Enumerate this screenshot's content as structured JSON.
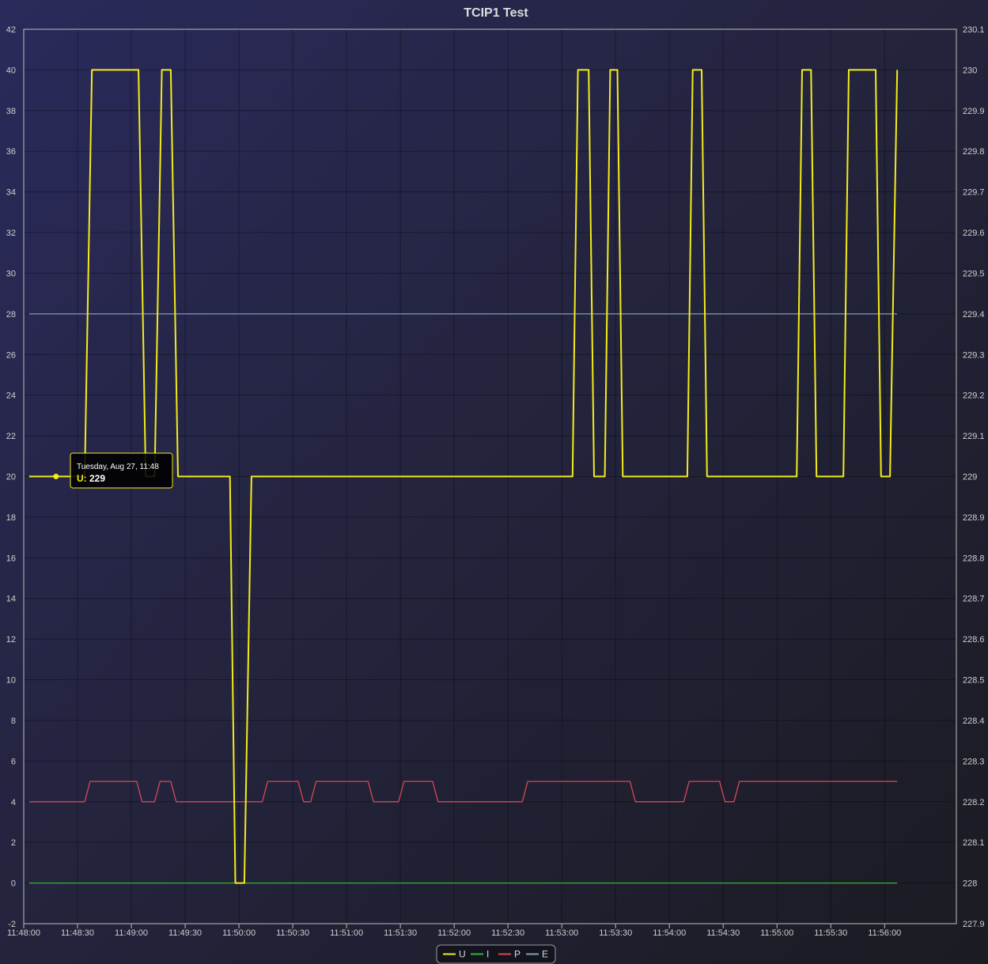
{
  "chart_data": {
    "type": "line",
    "title": "TCIP1 Test",
    "xlabel": "",
    "ylabel": "",
    "x_ticks": [
      "11:48:00",
      "11:48:30",
      "11:49:00",
      "11:49:30",
      "11:50:00",
      "11:50:30",
      "11:51:00",
      "11:51:30",
      "11:52:00",
      "11:52:30",
      "11:53:00",
      "11:53:30",
      "11:54:00",
      "11:54:30",
      "11:55:00",
      "11:55:30",
      "11:56:00"
    ],
    "xlim_seconds": [
      "11:48:00",
      "11:56:40"
    ],
    "ylim_left": [
      -2,
      42
    ],
    "ylim_right": [
      227.9,
      230.1
    ],
    "y_ticks_left": [
      "-2",
      "0",
      "2",
      "4",
      "6",
      "8",
      "10",
      "12",
      "14",
      "16",
      "18",
      "20",
      "22",
      "24",
      "26",
      "28",
      "30",
      "32",
      "34",
      "36",
      "38",
      "40",
      "42"
    ],
    "y_ticks_right": [
      "227.9",
      "228",
      "228.1",
      "228.2",
      "228.3",
      "228.4",
      "228.5",
      "228.6",
      "228.7",
      "228.8",
      "228.9",
      "229",
      "229.1",
      "229.2",
      "229.3",
      "229.4",
      "229.5",
      "229.6",
      "229.7",
      "229.8",
      "229.9",
      "230",
      "230.1"
    ],
    "grid": true,
    "legend_position": "bottom-center",
    "series": [
      {
        "name": "U",
        "axis": "left",
        "color": "#f3ec19",
        "points": [
          [
            "11:48:03",
            20
          ],
          [
            "11:48:34",
            20
          ],
          [
            "11:48:38",
            40
          ],
          [
            "11:49:04",
            40
          ],
          [
            "11:49:08",
            20
          ],
          [
            "11:49:13",
            20
          ],
          [
            "11:49:17",
            40
          ],
          [
            "11:49:22",
            40
          ],
          [
            "11:49:26",
            20
          ],
          [
            "11:49:55",
            20
          ],
          [
            "11:49:58",
            0
          ],
          [
            "11:50:03",
            0
          ],
          [
            "11:50:07",
            20
          ],
          [
            "11:53:06",
            20
          ],
          [
            "11:53:09",
            40
          ],
          [
            "11:53:15",
            40
          ],
          [
            "11:53:18",
            20
          ],
          [
            "11:53:24",
            20
          ],
          [
            "11:53:27",
            40
          ],
          [
            "11:53:31",
            40
          ],
          [
            "11:53:34",
            20
          ],
          [
            "11:54:10",
            20
          ],
          [
            "11:54:13",
            40
          ],
          [
            "11:54:18",
            40
          ],
          [
            "11:54:21",
            20
          ],
          [
            "11:55:11",
            20
          ],
          [
            "11:55:14",
            40
          ],
          [
            "11:55:19",
            40
          ],
          [
            "11:55:22",
            20
          ],
          [
            "11:55:37",
            20
          ],
          [
            "11:55:40",
            40
          ],
          [
            "11:55:55",
            40
          ],
          [
            "11:55:58",
            20
          ],
          [
            "11:56:03",
            20
          ],
          [
            "11:56:07",
            40
          ]
        ]
      },
      {
        "name": "I",
        "axis": "left",
        "color": "#33b533",
        "points": [
          [
            "11:48:03",
            0
          ],
          [
            "11:56:07",
            0
          ]
        ]
      },
      {
        "name": "P",
        "axis": "left",
        "color": "#d9484f",
        "points": [
          [
            "11:48:03",
            4
          ],
          [
            "11:48:34",
            4
          ],
          [
            "11:48:37",
            5
          ],
          [
            "11:49:03",
            5
          ],
          [
            "11:49:06",
            4
          ],
          [
            "11:49:13",
            4
          ],
          [
            "11:49:16",
            5
          ],
          [
            "11:49:22",
            5
          ],
          [
            "11:49:25",
            4
          ],
          [
            "11:50:13",
            4
          ],
          [
            "11:50:16",
            5
          ],
          [
            "11:50:33",
            5
          ],
          [
            "11:50:36",
            4
          ],
          [
            "11:50:40",
            4
          ],
          [
            "11:50:43",
            5
          ],
          [
            "11:51:12",
            5
          ],
          [
            "11:51:15",
            4
          ],
          [
            "11:51:29",
            4
          ],
          [
            "11:51:32",
            5
          ],
          [
            "11:51:48",
            5
          ],
          [
            "11:51:51",
            4
          ],
          [
            "11:52:38",
            4
          ],
          [
            "11:52:41",
            5
          ],
          [
            "11:53:38",
            5
          ],
          [
            "11:53:41",
            4
          ],
          [
            "11:54:08",
            4
          ],
          [
            "11:54:11",
            5
          ],
          [
            "11:54:28",
            5
          ],
          [
            "11:54:31",
            4
          ],
          [
            "11:54:36",
            4
          ],
          [
            "11:54:39",
            5
          ],
          [
            "11:56:07",
            5
          ]
        ]
      },
      {
        "name": "E",
        "axis": "left",
        "color": "#7e9fb8",
        "points": [
          [
            "11:48:03",
            28
          ],
          [
            "11:56:07",
            28
          ]
        ]
      }
    ],
    "tooltip": {
      "line1": "Tuesday, Aug 27, 11:48",
      "series_name": "U",
      "separator": ":",
      "value": "229",
      "point": [
        "11:48:18",
        20
      ]
    }
  }
}
